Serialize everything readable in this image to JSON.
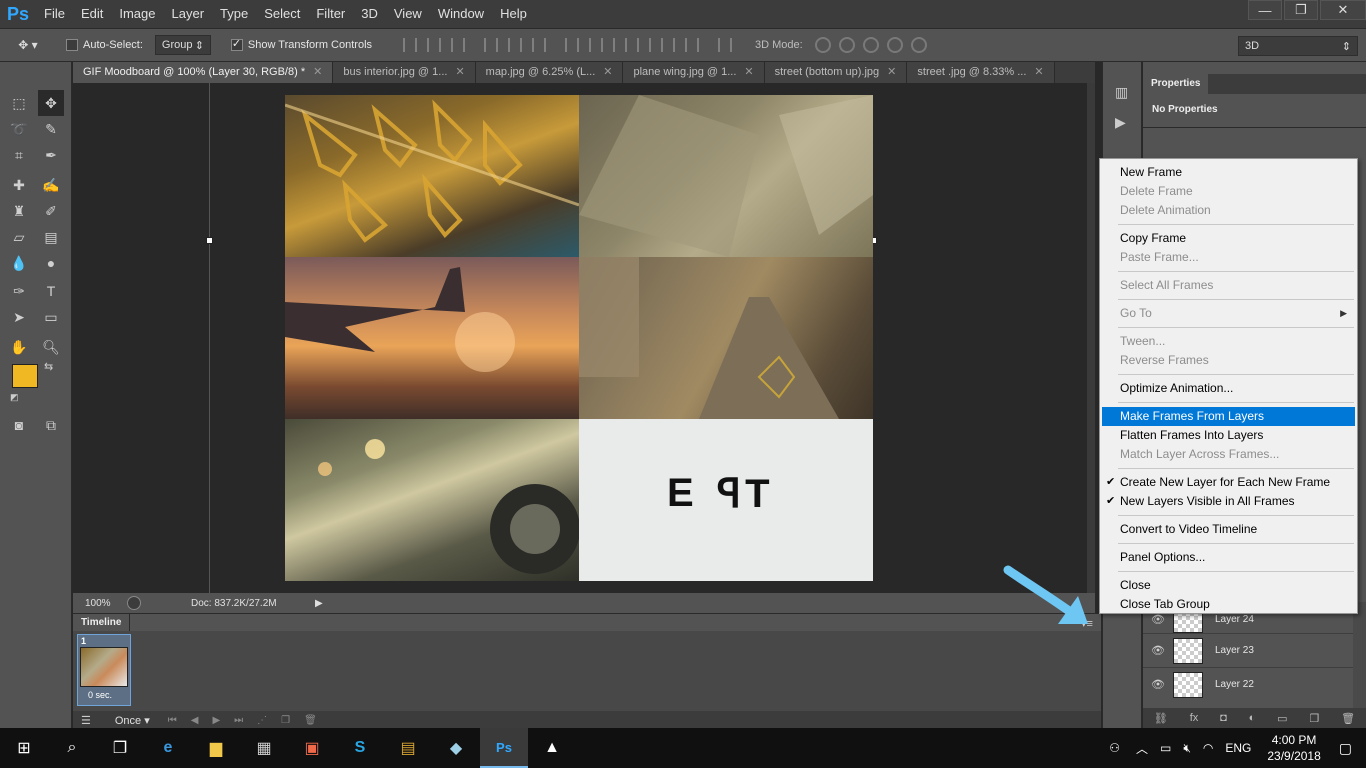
{
  "app": {
    "logo": "Ps"
  },
  "menubar": {
    "items": [
      "File",
      "Edit",
      "Image",
      "Layer",
      "Type",
      "Select",
      "Filter",
      "3D",
      "View",
      "Window",
      "Help"
    ]
  },
  "window_controls": {
    "minimize": "—",
    "restore": "❐",
    "close": "✕"
  },
  "options": {
    "auto_select_label": "Auto-Select:",
    "auto_select_checked": false,
    "group_value": "Group",
    "show_transform_label": "Show Transform Controls",
    "show_transform_checked": true,
    "mode_3d_label": "3D Mode:",
    "workspace_value": "3D"
  },
  "tabs": [
    {
      "label": "GIF Moodboard @ 100% (Layer 30, RGB/8) *",
      "active": true
    },
    {
      "label": "bus interior.jpg @ 1...",
      "active": false
    },
    {
      "label": "map.jpg @ 6.25% (L...",
      "active": false
    },
    {
      "label": "plane wing.jpg @ 1...",
      "active": false
    },
    {
      "label": "street (bottom up).jpg",
      "active": false
    },
    {
      "label": "street .jpg @ 8.33% ...",
      "active": false
    }
  ],
  "canvas": {
    "exit_text_left": "E",
    "exit_text_right": "ꟼT"
  },
  "status": {
    "zoom": "100%",
    "doc": "Doc: 837.2K/27.2M"
  },
  "timeline": {
    "tab_label": "Timeline",
    "frame_number": "1",
    "frame_delay": "0 sec.",
    "loop_value": "Once"
  },
  "properties": {
    "tab_label": "Properties",
    "body_text": "No Properties"
  },
  "layers": [
    {
      "name": "Layer 24"
    },
    {
      "name": "Layer 23"
    },
    {
      "name": "Layer 22"
    }
  ],
  "context_menu": [
    {
      "label": "New Frame",
      "disabled": false
    },
    {
      "label": "Delete Frame",
      "disabled": true
    },
    {
      "label": "Delete Animation",
      "disabled": true
    },
    {
      "sep": true
    },
    {
      "label": "Copy Frame",
      "disabled": false
    },
    {
      "label": "Paste Frame...",
      "disabled": true
    },
    {
      "sep": true
    },
    {
      "label": "Select All Frames",
      "disabled": true
    },
    {
      "sep": true
    },
    {
      "label": "Go To",
      "disabled": true,
      "submenu": true
    },
    {
      "sep": true
    },
    {
      "label": "Tween...",
      "disabled": true
    },
    {
      "label": "Reverse Frames",
      "disabled": true
    },
    {
      "sep": true
    },
    {
      "label": "Optimize Animation...",
      "disabled": false
    },
    {
      "sep": true
    },
    {
      "label": "Make Frames From Layers",
      "disabled": false,
      "highlighted": true
    },
    {
      "label": "Flatten Frames Into Layers",
      "disabled": false
    },
    {
      "label": "Match Layer Across Frames...",
      "disabled": true
    },
    {
      "sep": true
    },
    {
      "label": "Create New Layer for Each New Frame",
      "disabled": false,
      "checked": true
    },
    {
      "label": "New Layers Visible in All Frames",
      "disabled": false,
      "checked": true
    },
    {
      "sep": true
    },
    {
      "label": "Convert to Video Timeline",
      "disabled": false
    },
    {
      "sep": true
    },
    {
      "label": "Panel Options...",
      "disabled": false
    },
    {
      "sep": true
    },
    {
      "label": "Close",
      "disabled": false
    },
    {
      "label": "Close Tab Group",
      "disabled": false
    }
  ],
  "taskbar": {
    "language": "ENG",
    "time": "4:00 PM",
    "date": "23/9/2018"
  },
  "colors": {
    "foreground": "#f0b822",
    "background": "#ffffff",
    "highlight": "#0078d7",
    "annotation_arrow": "#6ec6f2"
  }
}
